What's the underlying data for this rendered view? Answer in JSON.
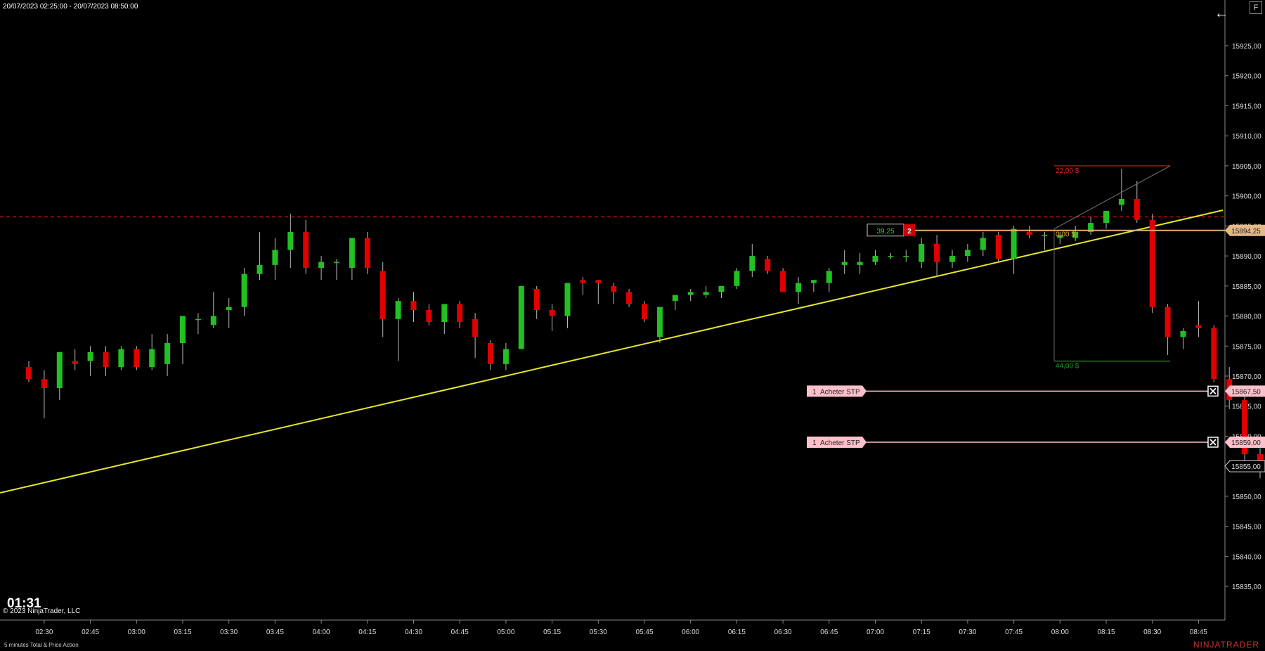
{
  "header": {
    "range": "20/07/2023 02:25:00 - 20/07/2023 08:50:00",
    "back_icon": "arrow-left-icon",
    "f_label": "F"
  },
  "footer": {
    "timer": "01:31",
    "copyright": "© 2023 NinjaTrader, LLC",
    "status": "5 minutes  Total & Price Action",
    "brand": "NINJATRADER"
  },
  "colors": {
    "up": "#22c022",
    "down": "#e00000",
    "wick": "#bbbbbb",
    "trend": "#e5e52a",
    "ref_line": "#dd1111",
    "order_line": "#ffc0cb",
    "entry_line": "#e0b070"
  },
  "trade": {
    "quantity": "39,25",
    "count": "2",
    "target_pnl": "22,00 $",
    "entry_pnl": "0,00 $",
    "stop_pnl": "44,00 $"
  },
  "orders": [
    {
      "qty": "1",
      "label": "Acheter STP",
      "price": "15867,50"
    },
    {
      "qty": "1",
      "label": "Acheter STP",
      "price": "15859,00"
    }
  ],
  "markers": {
    "entry": "15894,25",
    "last": "15855,00"
  },
  "chart_data": {
    "type": "candlestick",
    "y_range": [
      15831,
      15930
    ],
    "y_ticks": [
      "15925,00",
      "15920,00",
      "15915,00",
      "15910,00",
      "15905,00",
      "15900,00",
      "15895,00",
      "15890,00",
      "15885,00",
      "15880,00",
      "15875,00",
      "15870,00",
      "15865,00",
      "15860,00",
      "15855,00",
      "15850,00",
      "15845,00",
      "15840,00",
      "15835,00"
    ],
    "y_tick_values": [
      15925,
      15920,
      15915,
      15910,
      15905,
      15900,
      15895,
      15890,
      15885,
      15880,
      15875,
      15870,
      15865,
      15860,
      15855,
      15850,
      15845,
      15840,
      15835
    ],
    "x_ticks": [
      "02:30",
      "02:45",
      "03:00",
      "03:15",
      "03:30",
      "03:45",
      "04:00",
      "04:15",
      "04:30",
      "04:45",
      "05:00",
      "05:15",
      "05:30",
      "05:45",
      "06:00",
      "06:15",
      "06:30",
      "06:45",
      "07:00",
      "07:15",
      "07:30",
      "07:45",
      "08:00",
      "08:15",
      "08:30",
      "08:45"
    ],
    "ohlc": [
      [
        15871.5,
        15872.5,
        15869.0,
        15869.5
      ],
      [
        15869.5,
        15871.0,
        15863.0,
        15868.0
      ],
      [
        15868.0,
        15874.0,
        15866.0,
        15874.0
      ],
      [
        15872.5,
        15874.5,
        15871.0,
        15872.0
      ],
      [
        15872.5,
        15875.0,
        15870.0,
        15874.0
      ],
      [
        15874.0,
        15875.0,
        15870.0,
        15871.5
      ],
      [
        15871.5,
        15875.0,
        15871.0,
        15874.5
      ],
      [
        15874.5,
        15875.0,
        15871.0,
        15871.5
      ],
      [
        15871.5,
        15877.0,
        15871.0,
        15874.5
      ],
      [
        15872.0,
        15877.0,
        15870.0,
        15875.5
      ],
      [
        15875.5,
        15880.0,
        15872.0,
        15880.0
      ],
      [
        15879.5,
        15880.5,
        15877.0,
        15879.5
      ],
      [
        15878.5,
        15884.0,
        15878.0,
        15880.0
      ],
      [
        15881.0,
        15883.0,
        15878.0,
        15881.5
      ],
      [
        15881.5,
        15888.0,
        15880.0,
        15887.0
      ],
      [
        15887.0,
        15894.0,
        15886.0,
        15888.5
      ],
      [
        15888.5,
        15893.0,
        15886.0,
        15891.0
      ],
      [
        15891.0,
        15897.0,
        15888.0,
        15894.0
      ],
      [
        15894.0,
        15896.0,
        15887.0,
        15888.0
      ],
      [
        15888.0,
        15890.0,
        15886.0,
        15889.0
      ],
      [
        15889.0,
        15889.5,
        15886.0,
        15889.0
      ],
      [
        15888.0,
        15893.0,
        15886.0,
        15893.0
      ],
      [
        15893.0,
        15894.0,
        15887.0,
        15888.0
      ],
      [
        15887.5,
        15889.0,
        15876.5,
        15879.5
      ],
      [
        15879.5,
        15883.0,
        15872.5,
        15882.5
      ],
      [
        15882.5,
        15884.0,
        15879.0,
        15881.0
      ],
      [
        15881.0,
        15882.0,
        15878.5,
        15879.0
      ],
      [
        15879.0,
        15882.0,
        15877.0,
        15882.0
      ],
      [
        15882.0,
        15882.5,
        15878.0,
        15879.0
      ],
      [
        15879.5,
        15880.5,
        15873.0,
        15876.5
      ],
      [
        15875.5,
        15876.0,
        15871.0,
        15872.0
      ],
      [
        15872.0,
        15875.5,
        15871.0,
        15874.5
      ],
      [
        15874.5,
        15885.0,
        15874.5,
        15885.0
      ],
      [
        15884.5,
        15885.0,
        15879.5,
        15881.0
      ],
      [
        15881.0,
        15882.0,
        15877.5,
        15880.0
      ],
      [
        15880.0,
        15885.5,
        15878.0,
        15885.5
      ],
      [
        15886.0,
        15886.5,
        15883.5,
        15885.5
      ],
      [
        15886.0,
        15886.0,
        15882.0,
        15885.5
      ],
      [
        15885.0,
        15885.5,
        15882.0,
        15884.0
      ],
      [
        15884.0,
        15884.5,
        15881.5,
        15882.0
      ],
      [
        15882.0,
        15882.5,
        15879.0,
        15879.5
      ],
      [
        15876.5,
        15881.5,
        15875.5,
        15881.5
      ],
      [
        15882.5,
        15883.5,
        15881.0,
        15883.5
      ],
      [
        15883.5,
        15884.5,
        15882.5,
        15884.0
      ],
      [
        15883.5,
        15885.0,
        15883.0,
        15884.0
      ],
      [
        15884.0,
        15885.0,
        15883.0,
        15885.0
      ],
      [
        15885.0,
        15888.0,
        15884.5,
        15887.5
      ],
      [
        15887.5,
        15892.0,
        15886.5,
        15890.0
      ],
      [
        15889.5,
        15890.0,
        15887.0,
        15887.5
      ],
      [
        15887.5,
        15888.0,
        15884.0,
        15884.0
      ],
      [
        15884.0,
        15886.5,
        15882.0,
        15885.5
      ],
      [
        15885.5,
        15886.0,
        15884.0,
        15886.0
      ],
      [
        15885.5,
        15888.0,
        15884.0,
        15887.5
      ],
      [
        15888.5,
        15891.0,
        15887.0,
        15889.0
      ],
      [
        15888.5,
        15890.5,
        15887.0,
        15889.0
      ],
      [
        15889.0,
        15891.0,
        15888.5,
        15890.0
      ],
      [
        15890.0,
        15890.5,
        15889.5,
        15890.0
      ],
      [
        15890.0,
        15891.0,
        15889.0,
        15890.0
      ],
      [
        15889.0,
        15893.0,
        15888.0,
        15892.0
      ],
      [
        15892.0,
        15893.5,
        15886.5,
        15889.0
      ],
      [
        15889.0,
        15891.0,
        15888.0,
        15890.0
      ],
      [
        15890.0,
        15892.0,
        15889.0,
        15891.0
      ],
      [
        15891.0,
        15894.0,
        15890.0,
        15893.0
      ],
      [
        15893.5,
        15894.0,
        15889.0,
        15889.5
      ],
      [
        15889.5,
        15895.0,
        15887.0,
        15894.5
      ],
      [
        15894.0,
        15895.0,
        15893.0,
        15893.5
      ],
      [
        15893.5,
        15894.0,
        15891.0,
        15893.5
      ],
      [
        15893.0,
        15894.0,
        15892.0,
        15893.5
      ],
      [
        15893.0,
        15895.0,
        15892.5,
        15894.0
      ],
      [
        15894.0,
        15896.5,
        15893.5,
        15895.5
      ],
      [
        15895.5,
        15897.0,
        15894.5,
        15897.5
      ],
      [
        15898.5,
        15904.5,
        15897.5,
        15899.5
      ],
      [
        15899.5,
        15902.5,
        15895.5,
        15896.0
      ],
      [
        15896.0,
        15897.0,
        15880.5,
        15881.5
      ],
      [
        15881.5,
        15882.0,
        15873.5,
        15876.5
      ],
      [
        15876.5,
        15878.0,
        15874.5,
        15877.5
      ],
      [
        15878.5,
        15882.5,
        15876.5,
        15878.0
      ],
      [
        15878.0,
        15878.5,
        15869.0,
        15869.5
      ],
      [
        15869.5,
        15871.5,
        15864.5,
        15866.0
      ],
      [
        15866.0,
        15867.0,
        15855.0,
        15857.0
      ],
      [
        15857.0,
        15858.0,
        15853.0,
        15855.0
      ]
    ]
  }
}
